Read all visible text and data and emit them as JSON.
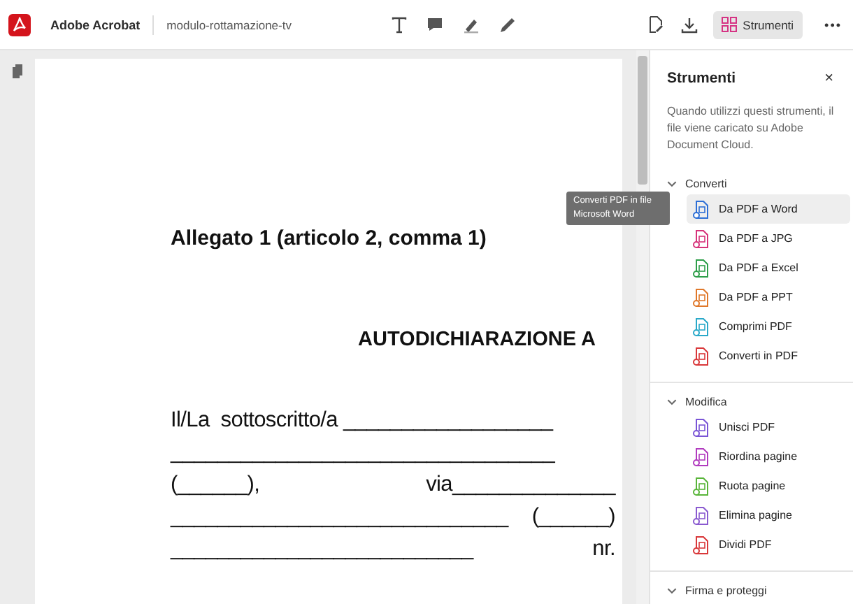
{
  "app": {
    "name": "Adobe Acrobat",
    "file": "modulo-rottamazione-tv"
  },
  "toolbar": {
    "tools_button": {
      "label": "Strumenti",
      "selected": true
    },
    "more": "•••"
  },
  "document": {
    "heading": "Allegato 1 (articolo 2, comma 1)",
    "title": "AUTODICHIARAZIONE A",
    "lines": [
      {
        "parts": [
          "Il/La  sottoscritto/a __________________"
        ]
      },
      {
        "parts": [
          "_________________________________"
        ]
      },
      {
        "parts": [
          "(______),",
          "via______________"
        ]
      },
      {
        "parts": [
          "_____________________________",
          "(______)"
        ]
      },
      {
        "parts": [
          "__________________________",
          "nr."
        ]
      }
    ]
  },
  "tooltip": "Converti PDF in file Microsoft Word",
  "panel": {
    "title": "Strumenti",
    "close": "×",
    "description": "Quando utilizzi questi strumenti, il file viene caricato su Adobe Document Cloud.",
    "sections": [
      {
        "title": "Converti",
        "expanded": true,
        "items": [
          {
            "label": "Da PDF a Word",
            "color": "#2d6fd6",
            "selected": true
          },
          {
            "label": "Da PDF a JPG",
            "color": "#d6337a",
            "selected": false
          },
          {
            "label": "Da PDF a Excel",
            "color": "#2e9e4a",
            "selected": false
          },
          {
            "label": "Da PDF a PPT",
            "color": "#e0782a",
            "selected": false
          },
          {
            "label": "Comprimi PDF",
            "color": "#2aa9c9",
            "selected": false
          },
          {
            "label": "Converti in PDF",
            "color": "#d9383a",
            "selected": false
          }
        ]
      },
      {
        "title": "Modifica",
        "expanded": true,
        "items": [
          {
            "label": "Unisci PDF",
            "color": "#7a55d6",
            "selected": false
          },
          {
            "label": "Riordina pagine",
            "color": "#b13bbf",
            "selected": false
          },
          {
            "label": "Ruota pagine",
            "color": "#59b53a",
            "selected": false
          },
          {
            "label": "Elimina pagine",
            "color": "#8a5ad0",
            "selected": false
          },
          {
            "label": "Dividi PDF",
            "color": "#d9383a",
            "selected": false
          }
        ]
      },
      {
        "title": "Firma e proteggi",
        "expanded": true
      }
    ]
  }
}
